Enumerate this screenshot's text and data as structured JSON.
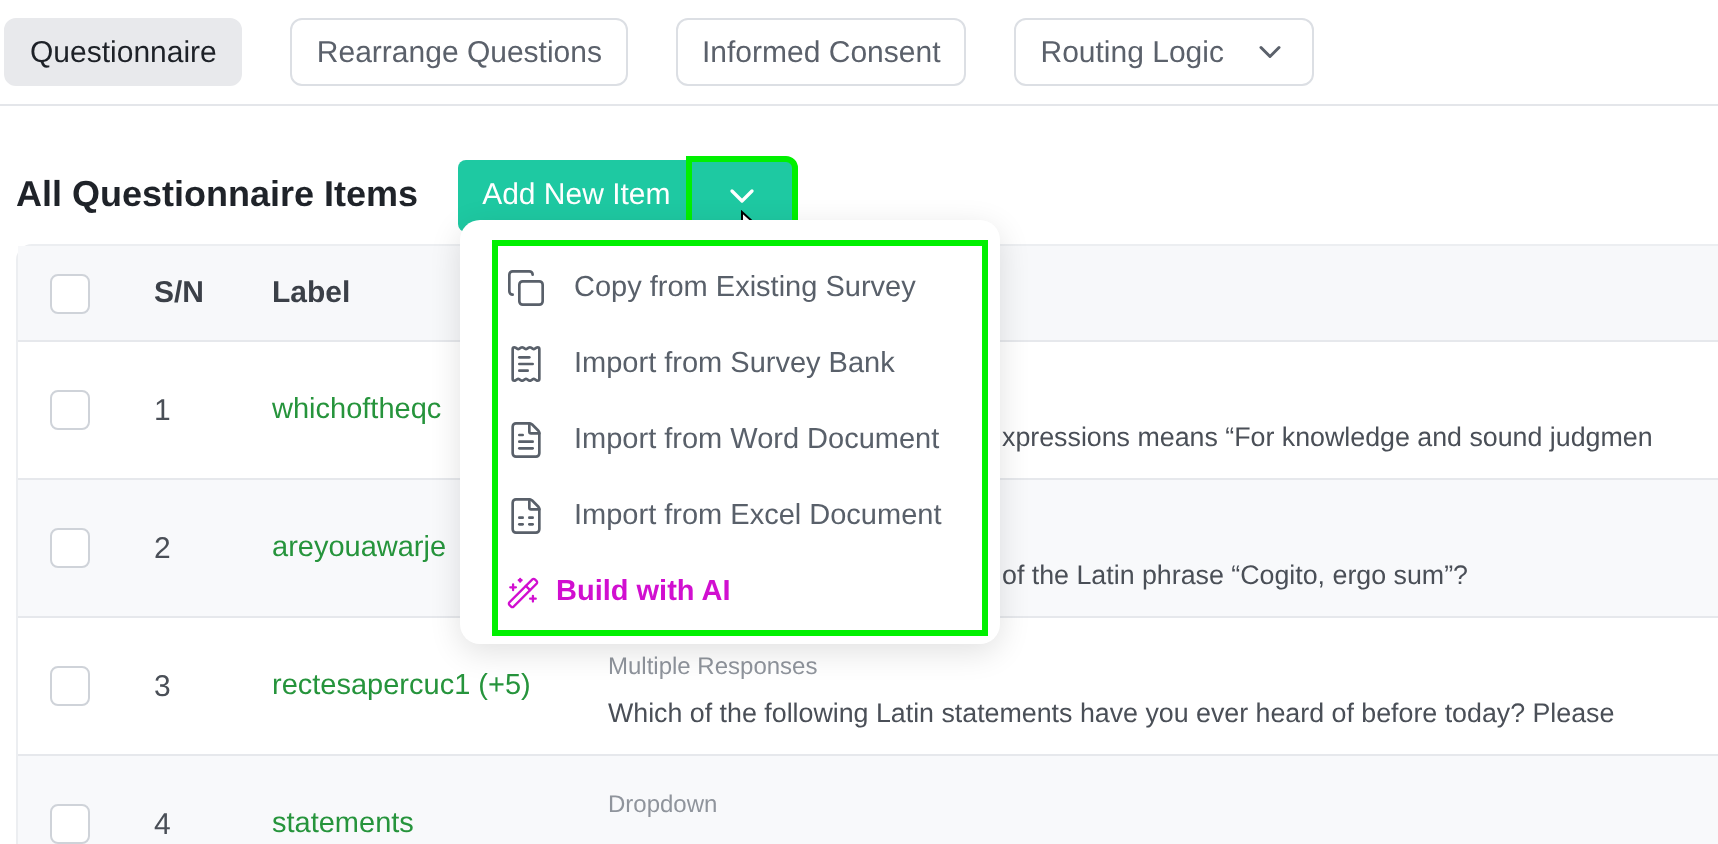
{
  "tabs": [
    {
      "label": "Questionnaire",
      "selected": true,
      "kind": "tab"
    },
    {
      "label": "Rearrange Questions",
      "selected": false,
      "kind": "tab"
    },
    {
      "label": "Informed Consent",
      "selected": false,
      "kind": "tab"
    },
    {
      "label": "Routing Logic",
      "selected": false,
      "kind": "dropdown"
    }
  ],
  "section": {
    "title": "All Questionnaire Items",
    "add_button": "Add New Item",
    "menu_open": true
  },
  "table": {
    "columns": [
      "S/N",
      "Label"
    ],
    "select_all_checked": false,
    "rows": [
      {
        "checked": false,
        "sn": "1",
        "label": "whichoftheqc",
        "question": "xpressions means “For knowledge and sound judgmen"
      },
      {
        "checked": false,
        "sn": "2",
        "label": "areyouawarje",
        "question": "of the Latin phrase “Cogito, ergo sum”?"
      },
      {
        "checked": false,
        "sn": "3",
        "label": "rectesapercuc1 (+5)",
        "type": "Multiple Responses",
        "question": "Which of the following Latin statements have you ever heard of before today? Please"
      },
      {
        "checked": false,
        "sn": "4",
        "label": "statements",
        "type": "Dropdown"
      }
    ]
  },
  "menu": [
    {
      "label": "Copy from Existing Survey",
      "kind": "import"
    },
    {
      "label": "Import from Survey Bank",
      "kind": "import"
    },
    {
      "label": "Import from Word Document",
      "kind": "import"
    },
    {
      "label": "Import from Excel Document",
      "kind": "import"
    },
    {
      "label": "Build with AI",
      "kind": "ai"
    }
  ]
}
